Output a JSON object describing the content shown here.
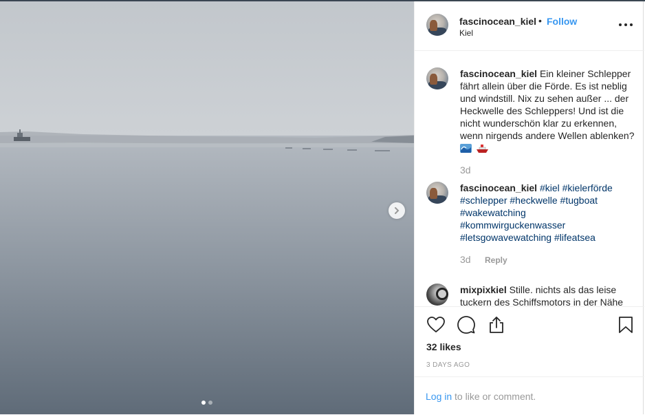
{
  "header": {
    "username": "fascinocean_kiel",
    "separator": "•",
    "follow_label": "Follow",
    "location": "Kiel"
  },
  "media": {
    "slides": 2,
    "active_slide": 1
  },
  "comments": [
    {
      "username": "fascinocean_kiel",
      "text": "Ein kleiner Schlepper fährt allein über die Förde. Es ist neblig und windstill. Nix zu sehen außer ... der Heckwelle des Schleppers! Und ist die nicht wunderschön klar zu erkennen, wenn nirgends andere Wellen ablenken?",
      "emojis": [
        "water-wave-emoji",
        "ship-emoji"
      ],
      "time": "3d"
    },
    {
      "username": "fascinocean_kiel",
      "hashtags": [
        "#kiel",
        "#kielerförde",
        "#schlepper",
        "#heckwelle",
        "#tugboat",
        "#wakewatching",
        "#kommwirguckenwasser",
        "#letsgowavewatching",
        "#lifeatsea"
      ],
      "time": "3d",
      "reply_label": "Reply"
    },
    {
      "username": "mixpixkiel",
      "text": "Stille. nichts als das leise tuckern des Schiffsmotors in der Nähe"
    }
  ],
  "actions": {
    "icons": [
      "heart-icon",
      "comment-icon",
      "share-icon",
      "bookmark-icon"
    ]
  },
  "likes": "32 likes",
  "timestamp": "3 DAYS AGO",
  "login": {
    "link_label": "Log in",
    "suffix": " to like or comment."
  },
  "colors": {
    "link": "#3897f0",
    "hashtag": "#003569",
    "muted": "#999999",
    "text": "#262626"
  }
}
